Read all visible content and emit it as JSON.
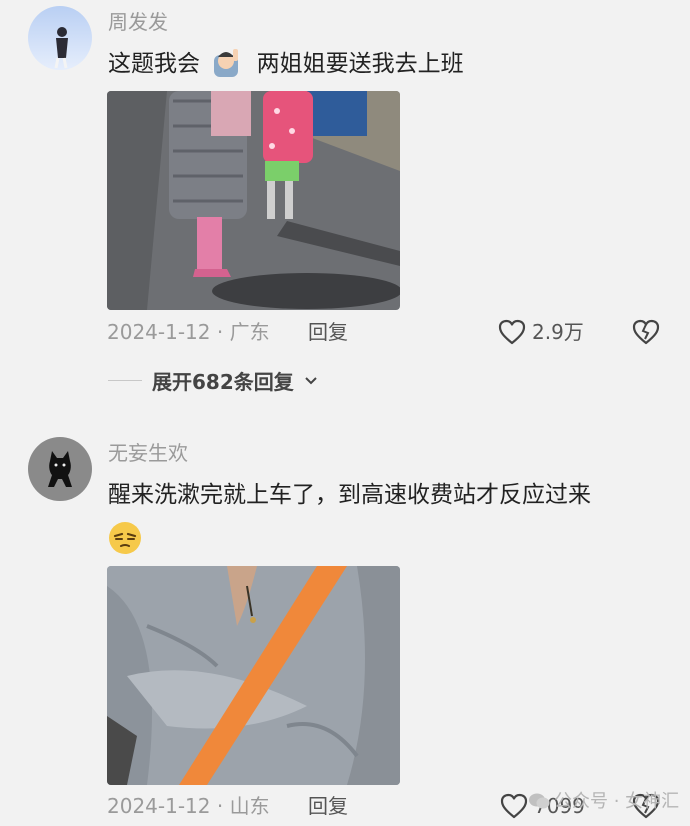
{
  "comments": [
    {
      "username": "周发发",
      "text": "这题我会",
      "text_after_emoji": "两姐姐要送我去上班",
      "inline_emoji": "raising-hand-emoji",
      "date_location": "2024-1-12 · 广东",
      "reply_label": "回复",
      "like_count": "2.9万",
      "expand_label": "展开682条回复"
    },
    {
      "username": "无妄生欢",
      "text": "醒来洗漱完就上车了，到高速收费站才反应过来",
      "emoji": "squinting-face-emoji",
      "date_location": "2024-1-12 · 山东",
      "reply_label": "回复",
      "like_count": "7099"
    }
  ],
  "watermark": "公众号 · 女神汇",
  "colors": {
    "background": "#f2f2f2",
    "username": "#9a9a9a",
    "text": "#222222",
    "seatbelt": "#f0883a"
  }
}
